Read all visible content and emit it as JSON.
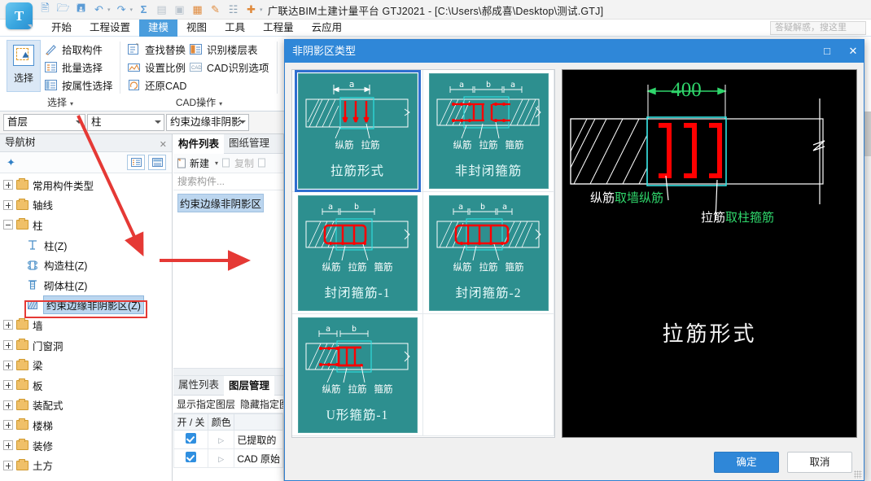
{
  "window": {
    "title": "广联达BIM土建计量平台 GTJ2021 - [C:\\Users\\郝成喜\\Desktop\\测试.GTJ]",
    "help_placeholder": "答疑解惑，搜这里",
    "logo_letter": "T"
  },
  "quick_access": [
    {
      "name": "new-icon",
      "glyph": "⎘"
    },
    {
      "name": "open-icon",
      "glyph": "὜1"
    },
    {
      "name": "save-icon",
      "glyph": "ὋE"
    },
    {
      "name": "undo-icon",
      "glyph": "↶"
    },
    {
      "name": "redo-icon",
      "glyph": "↷"
    },
    {
      "name": "sum-icon",
      "glyph": "Σ"
    },
    {
      "name": "report-icon",
      "glyph": "▤"
    },
    {
      "name": "preview-icon",
      "glyph": "ὐD"
    },
    {
      "name": "table-icon",
      "glyph": "▦"
    },
    {
      "name": "pen-icon",
      "glyph": "✎"
    },
    {
      "name": "grid-icon",
      "glyph": "⌗"
    },
    {
      "name": "add-doc-icon",
      "glyph": "➕"
    },
    {
      "name": "qat-more-icon",
      "glyph": "≡"
    }
  ],
  "ribbon_tabs": [
    {
      "label": "开始",
      "active": false
    },
    {
      "label": "工程设置",
      "active": false
    },
    {
      "label": "建模",
      "active": true
    },
    {
      "label": "视图",
      "active": false
    },
    {
      "label": "工具",
      "active": false
    },
    {
      "label": "工程量",
      "active": false
    },
    {
      "label": "云应用",
      "active": false
    }
  ],
  "ribbon": {
    "select_group": {
      "big_button": "选择",
      "items": [
        "拾取构件",
        "批量选择",
        "按属性选择"
      ],
      "label": "选择"
    },
    "cad_group": {
      "items_col1": [
        "查找替换",
        "设置比例",
        "还原CAD"
      ],
      "items_col2": [
        "识别楼层表",
        "CAD识别选项"
      ],
      "label": "CAD操作"
    }
  },
  "selector_bar": {
    "floor": "首层",
    "category": "柱",
    "component": "约束边缘非阴影"
  },
  "nav_panel": {
    "header": "导航树",
    "tree": [
      {
        "label": "常用构件类型",
        "type": "folder",
        "level": 0,
        "expander": "plus"
      },
      {
        "label": "轴线",
        "type": "folder",
        "level": 0,
        "expander": "plus"
      },
      {
        "label": "柱",
        "type": "folder",
        "level": 0,
        "expander": "minus"
      },
      {
        "label": "柱(Z)",
        "type": "leaf",
        "level": 1,
        "icon": "column-icon"
      },
      {
        "label": "构造柱(Z)",
        "type": "leaf",
        "level": 1,
        "icon": "structural-column-icon"
      },
      {
        "label": "砌体柱(Z)",
        "type": "leaf",
        "level": 1,
        "icon": "masonry-column-icon"
      },
      {
        "label": "约束边缘非阴影区(Z)",
        "type": "leaf",
        "level": 1,
        "icon": "hatch-icon",
        "selected": true
      },
      {
        "label": "墙",
        "type": "folder",
        "level": 0,
        "expander": "plus"
      },
      {
        "label": "门窗洞",
        "type": "folder",
        "level": 0,
        "expander": "plus"
      },
      {
        "label": "梁",
        "type": "folder",
        "level": 0,
        "expander": "plus"
      },
      {
        "label": "板",
        "type": "folder",
        "level": 0,
        "expander": "plus"
      },
      {
        "label": "装配式",
        "type": "folder",
        "level": 0,
        "expander": "plus"
      },
      {
        "label": "楼梯",
        "type": "folder",
        "level": 0,
        "expander": "plus"
      },
      {
        "label": "装修",
        "type": "folder",
        "level": 0,
        "expander": "plus"
      },
      {
        "label": "土方",
        "type": "folder",
        "level": 0,
        "expander": "plus"
      }
    ]
  },
  "mid_panel": {
    "tabs_top": [
      {
        "label": "构件列表",
        "active": true
      },
      {
        "label": "图纸管理",
        "active": false
      }
    ],
    "toolbar": [
      {
        "label": "新建",
        "disabled": false,
        "caret": true
      },
      {
        "label": "复制",
        "disabled": true,
        "caret": false
      },
      {
        "label": "",
        "disabled": true,
        "caret": false
      }
    ],
    "search_placeholder": "搜索构件...",
    "components": [
      "约束边缘非阴影区"
    ],
    "tabs_bottom": [
      {
        "label": "属性列表",
        "active": false
      },
      {
        "label": "图层管理",
        "active": true
      }
    ],
    "layer_actions": [
      "显示指定图层",
      "隐藏指定图"
    ],
    "layer_table": {
      "headers": [
        "开 / 关",
        "颜色",
        ""
      ],
      "rows": [
        {
          "on": true,
          "color": "▷",
          "name": "已提取的"
        },
        {
          "on": true,
          "color": "▷",
          "name": "CAD 原始"
        }
      ]
    }
  },
  "dialog": {
    "title": "非阴影区类型",
    "maximize_icon": "□",
    "close_icon": "✕",
    "cards": [
      {
        "id": "latie",
        "caption": "拉筋形式",
        "labels": [
          "纵筋",
          "拉筋"
        ],
        "dims": [
          "a"
        ],
        "selected": true
      },
      {
        "id": "open-stirrup",
        "caption": "非封闭箍筋",
        "labels": [
          "纵筋",
          "拉筋",
          "箍筋"
        ],
        "dims": [
          "a",
          "b",
          "a"
        ],
        "selected": false
      },
      {
        "id": "closed-stirrup-1",
        "caption": "封闭箍筋-1",
        "labels": [
          "纵筋",
          "拉筋",
          "箍筋"
        ],
        "dims": [
          "a",
          "b"
        ],
        "selected": false
      },
      {
        "id": "closed-stirrup-2",
        "caption": "封闭箍筋-2",
        "labels": [
          "纵筋",
          "拉筋",
          "箍筋"
        ],
        "dims": [
          "a",
          "b",
          "a"
        ],
        "selected": false
      },
      {
        "id": "u-stirrup-1",
        "caption": "U形箍筋-1",
        "labels": [
          "纵筋",
          "拉筋",
          "箍筋"
        ],
        "dims": [
          "a",
          "b"
        ],
        "selected": false
      }
    ],
    "preview": {
      "title": "拉筋形式",
      "dimension": "400",
      "annotations": [
        {
          "white": "纵筋",
          "green": "取墙纵筋"
        },
        {
          "white": "拉筋",
          "green": "取柱箍筋"
        }
      ]
    },
    "ok_label": "确定",
    "cancel_label": "取消"
  },
  "colors": {
    "accent": "#2f87d8",
    "card_bg": "#2d8f8f",
    "rebar_red": "#ff0000",
    "dim_cyan": "#2fe0e0",
    "green": "#2fd66b",
    "annotation_red": "#e53935",
    "tab_active": "#4a9ddd"
  }
}
